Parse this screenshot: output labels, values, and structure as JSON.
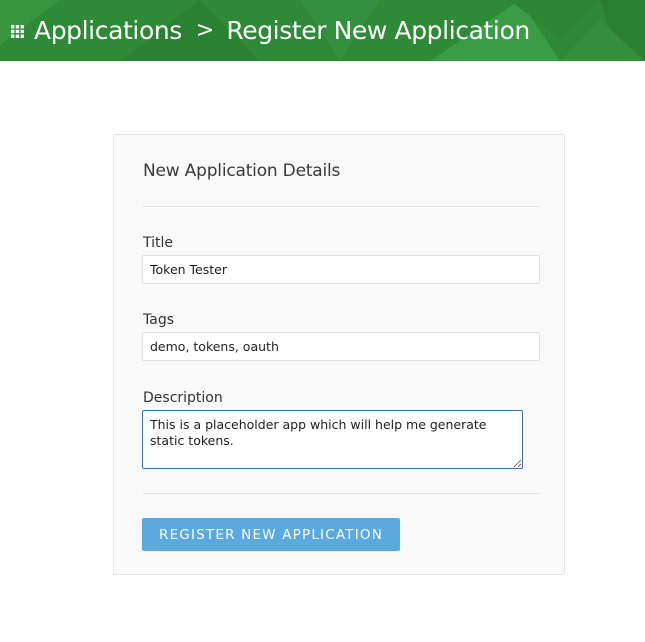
{
  "header": {
    "icon": "grid-icon",
    "breadcrumb": [
      "Applications",
      "Register New Application"
    ],
    "separator": ">",
    "background": "#2e8a36"
  },
  "panel": {
    "title": "New Application Details",
    "fields": {
      "title": {
        "label": "Title",
        "value": "Token Tester"
      },
      "tags": {
        "label": "Tags",
        "value": "demo, tokens, oauth"
      },
      "description": {
        "label": "Description",
        "value": "This is a placeholder app which will help me generate static tokens."
      }
    },
    "submit_label": "REGISTER NEW APPLICATION",
    "submit_color": "#5aaadf"
  }
}
